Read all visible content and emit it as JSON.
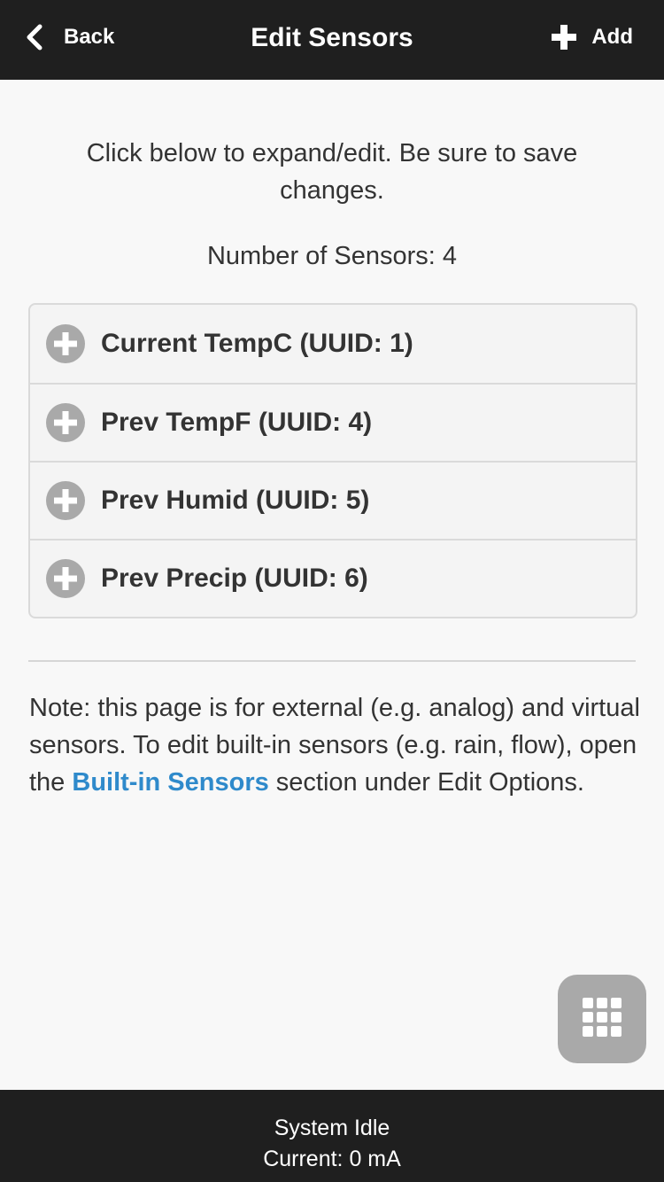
{
  "header": {
    "back_label": "Back",
    "title": "Edit Sensors",
    "add_label": "Add",
    "back_icon": "chevron-left-icon",
    "add_icon": "plus-icon"
  },
  "main": {
    "intro": "Click below to expand/edit. Be sure to save changes.",
    "count": "Number of Sensors: 4",
    "sensors": [
      {
        "label": "Current TempC (UUID: 1)",
        "icon": "plus-circle-icon"
      },
      {
        "label": "Prev TempF (UUID: 4)",
        "icon": "plus-circle-icon"
      },
      {
        "label": "Prev Humid (UUID: 5)",
        "icon": "plus-circle-icon"
      },
      {
        "label": "Prev Precip (UUID: 6)",
        "icon": "plus-circle-icon"
      }
    ],
    "note": {
      "before": "Note: this page is for external (e.g. analog) and virtual sensors. To edit built-in sensors (e.g. rain, flow), open the ",
      "link": "Built-in Sensors",
      "after": " section under Edit Options."
    }
  },
  "fab": {
    "icon": "grid-icon"
  },
  "footer": {
    "status": "System Idle",
    "current": "Current: 0 mA"
  },
  "colors": {
    "header_bg": "#1f1f1f",
    "link": "#2f8acb",
    "icon_gray": "#a9a9a9",
    "page_bg": "#f8f8f8"
  }
}
